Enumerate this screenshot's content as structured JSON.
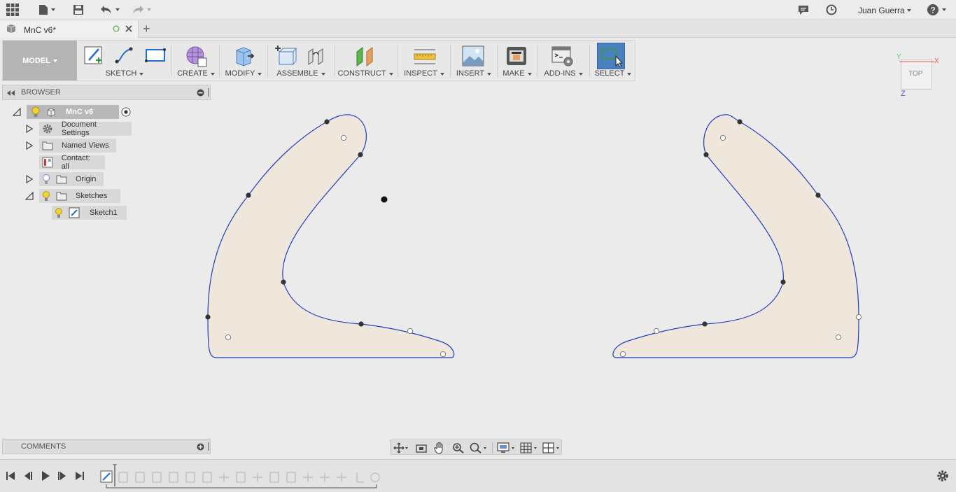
{
  "app": {
    "user": "Juan Guerra",
    "icons": [
      "apps-grid-icon",
      "file-icon",
      "save-icon",
      "undo-icon",
      "redo-icon",
      "notifications-icon",
      "history-icon",
      "help-icon"
    ]
  },
  "tab": {
    "title": "MnC v6*",
    "add_tab_symbol": "+"
  },
  "toolbar": {
    "model_label": "MODEL",
    "groups": [
      {
        "label": "SKETCH"
      },
      {
        "label": "CREATE"
      },
      {
        "label": "MODIFY"
      },
      {
        "label": "ASSEMBLE"
      },
      {
        "label": "CONSTRUCT"
      },
      {
        "label": "INSPECT"
      },
      {
        "label": "INSERT"
      },
      {
        "label": "MAKE"
      },
      {
        "label": "ADD-INS"
      },
      {
        "label": "SELECT"
      }
    ]
  },
  "browser": {
    "title": "BROWSER",
    "root": "MnC v6",
    "items": [
      {
        "label": "Document Settings"
      },
      {
        "label": "Named Views"
      },
      {
        "label": "Contact: all"
      },
      {
        "label": "Origin"
      },
      {
        "label": "Sketches"
      },
      {
        "label": "Sketch1"
      }
    ]
  },
  "comments": {
    "title": "COMMENTS"
  },
  "viewcube": {
    "face": "TOP",
    "axis_x": "X",
    "axis_y": "Y",
    "axis_z": "Z"
  },
  "colors": {
    "profile_fill": "#efe6dc",
    "profile_stroke": "#1f3fbf",
    "select_active": "#4a7fc0"
  }
}
